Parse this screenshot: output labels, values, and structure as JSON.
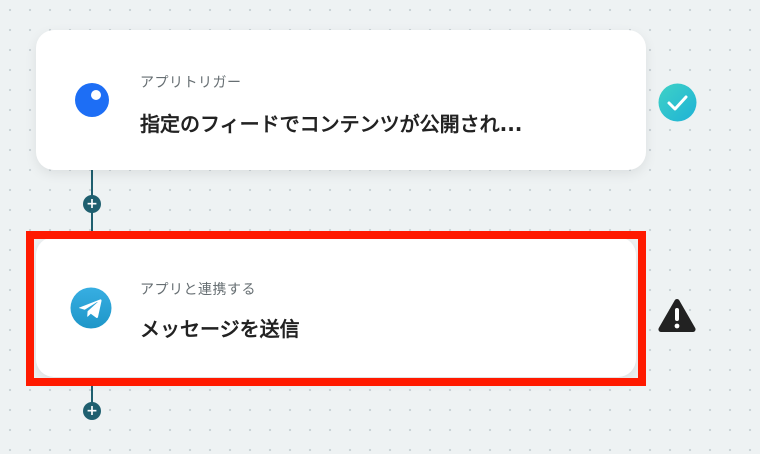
{
  "flow": {
    "steps": [
      {
        "label": "アプリトリガー",
        "title": "指定のフィードでコンテンツが公開され...",
        "icon": "blue-dot-icon",
        "status": "completed-check-icon"
      },
      {
        "label": "アプリと連携する",
        "title": "メッセージを送信",
        "icon": "telegram-icon",
        "status": "warning-icon"
      }
    ],
    "add_step_symbol": "+"
  },
  "colors": {
    "background": "#eef2f3",
    "connector": "#1f5f6f",
    "highlight": "#ff1a00",
    "check": "#2bc4c9",
    "trigger_icon": "#1d6ef5",
    "telegram": "#2aa3e0",
    "warning": "#222222"
  }
}
